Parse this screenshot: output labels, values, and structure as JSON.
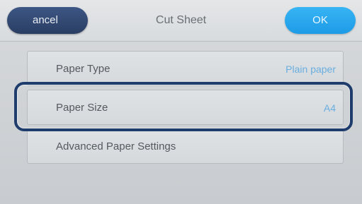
{
  "header": {
    "title": "Cut Sheet",
    "cancel_label": "ancel",
    "ok_label": "OK"
  },
  "menu": {
    "items": [
      {
        "label": "Paper Type",
        "value": "Plain paper"
      },
      {
        "label": "Paper Size",
        "value": "A4",
        "selected": true
      },
      {
        "label": "Advanced Paper Settings",
        "value": ""
      }
    ]
  },
  "colors": {
    "cancel_button": "#2f4670",
    "ok_button": "#27a6ee",
    "value_text": "#68aee0",
    "focus_ring": "#1e3d6c"
  }
}
